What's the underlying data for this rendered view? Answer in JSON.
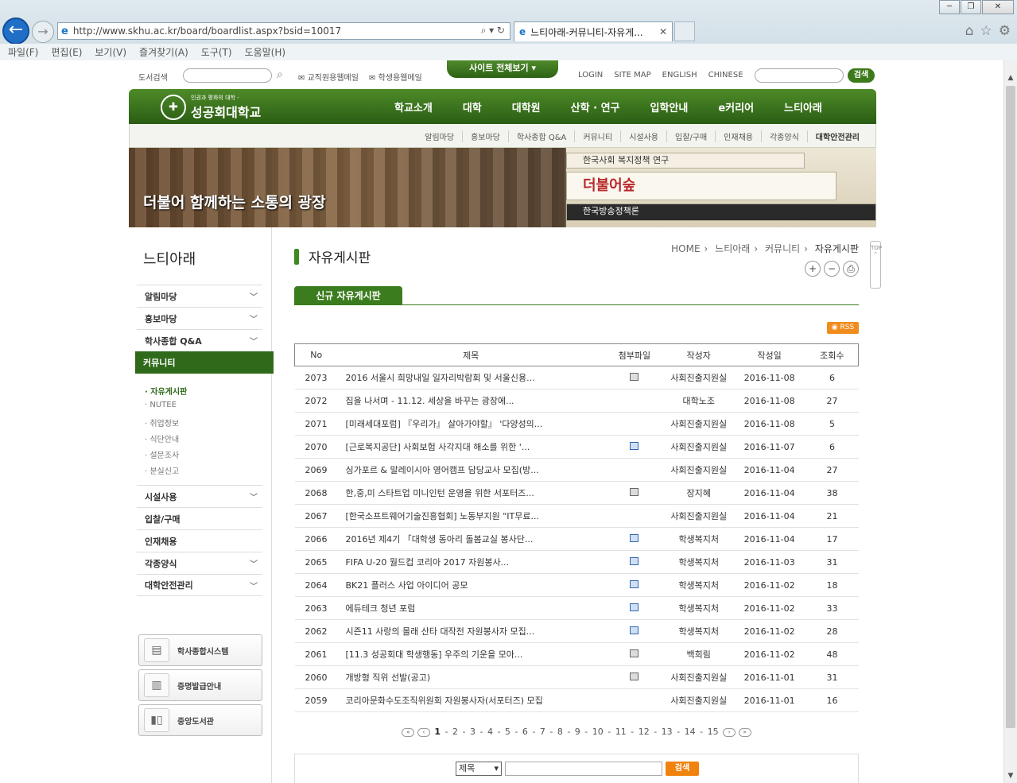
{
  "browser": {
    "url": "http://www.skhu.ac.kr/board/boardlist.aspx?bsid=10017",
    "tab_title": "느티아래-커뮤니티-자유게...",
    "menu": [
      "파일(F)",
      "편집(E)",
      "보기(V)",
      "즐겨찾기(A)",
      "도구(T)",
      "도움말(H)"
    ]
  },
  "util": {
    "library_search": "도서검색",
    "faculty_mail": "교직원용웹메일",
    "student_mail": "학생용웹메일",
    "sitemap_toggle": "사이트 전체보기",
    "links": [
      "LOGIN",
      "SITE MAP",
      "ENGLISH",
      "CHINESE"
    ],
    "search_button": "검색"
  },
  "logo": {
    "slogan": "인권과 평화의 대학 -",
    "name": "성공회대학교"
  },
  "gnb": [
    "학교소개",
    "대학",
    "대학원",
    "산학 · 연구",
    "입학안내",
    "e커리어",
    "느티아래"
  ],
  "lnb": [
    "알림마당",
    "홍보마당",
    "학사종합 Q&A",
    "커뮤니티",
    "시설사용",
    "입찰/구매",
    "인재채용",
    "각종양식",
    "대학안전관리"
  ],
  "banner": {
    "slogan": "더불어 함께하는 소통의 광장",
    "book1": "한국사회 복지정책 연구",
    "book2": "더불어숲",
    "book3": "한국방송정책론"
  },
  "sidebar": {
    "title": "느티아래",
    "items": [
      {
        "label": "알림마당",
        "chevron": true
      },
      {
        "label": "홍보마당",
        "chevron": true
      },
      {
        "label": "학사종합 Q&A",
        "chevron": true
      },
      {
        "label": "커뮤니티",
        "chevron": false
      }
    ],
    "sub": [
      "· 자유게시판",
      "· NUTEE",
      "· 취업정보",
      "· 식단안내",
      "· 설문조사",
      "· 분실신고"
    ],
    "items2": [
      {
        "label": "시설사용",
        "chevron": true
      },
      {
        "label": "입찰/구매",
        "chevron": false
      },
      {
        "label": "인재채용",
        "chevron": false
      },
      {
        "label": "각종양식",
        "chevron": true
      },
      {
        "label": "대학안전관리",
        "chevron": true
      }
    ],
    "quick": [
      "학사종합시스템",
      "증명발급안내",
      "중앙도서관"
    ]
  },
  "main": {
    "title": "자유게시판",
    "breadcrumb": [
      "HOME",
      "느티아래",
      "커뮤니티",
      "자유게시판"
    ],
    "board_tab": "신규 자유게시판",
    "rss": "RSS",
    "columns": [
      "No",
      "제목",
      "첨부파일",
      "작성자",
      "작성일",
      "조회수"
    ],
    "rows": [
      {
        "no": "2073",
        "title": "2016 서울시 희망내일 일자리박람회 및 서울신용...",
        "attach": "disk",
        "author": "사회진출지원실",
        "date": "2016-11-08",
        "views": "6"
      },
      {
        "no": "2072",
        "title": "집을 나서며 - 11.12. 세상을 바꾸는 광장에...",
        "attach": "",
        "author": "대학노조",
        "date": "2016-11-08",
        "views": "27"
      },
      {
        "no": "2071",
        "title": "[미래세대포럼] 『우리가』 살아가야할』 '다양성의...",
        "attach": "",
        "author": "사회진출지원실",
        "date": "2016-11-08",
        "views": "5"
      },
      {
        "no": "2070",
        "title": "[근로복지공단] 사회보험 사각지대 해소를 위한 '...",
        "attach": "doc",
        "author": "사회진출지원실",
        "date": "2016-11-07",
        "views": "6"
      },
      {
        "no": "2069",
        "title": "싱가포르 & 말레이시아 영어캠프 담당교사 모집(방...",
        "attach": "",
        "author": "사회진출지원실",
        "date": "2016-11-04",
        "views": "27"
      },
      {
        "no": "2068",
        "title": "한,중,미 스타트업 미니인턴 운영을 위한 서포터즈...",
        "attach": "disk",
        "author": "장지혜",
        "date": "2016-11-04",
        "views": "38"
      },
      {
        "no": "2067",
        "title": "[한국소프트웨어기술진흥협회] 노동부지원 \"IT무료...",
        "attach": "",
        "author": "사회진출지원실",
        "date": "2016-11-04",
        "views": "21"
      },
      {
        "no": "2066",
        "title": "2016년 제4기 「대학생 동아리 돌봄교실 봉사단...",
        "attach": "doc",
        "author": "학생복지처",
        "date": "2016-11-04",
        "views": "17"
      },
      {
        "no": "2065",
        "title": "FIFA U-20 월드컵 코리아 2017 자원봉사...",
        "attach": "doc",
        "author": "학생복지처",
        "date": "2016-11-03",
        "views": "31"
      },
      {
        "no": "2064",
        "title": "BK21 플러스 사업 아이디어 공모",
        "attach": "doc",
        "author": "학생복지처",
        "date": "2016-11-02",
        "views": "18"
      },
      {
        "no": "2063",
        "title": "에듀테크 청년 포럼",
        "attach": "doc",
        "author": "학생복지처",
        "date": "2016-11-02",
        "views": "33"
      },
      {
        "no": "2062",
        "title": "시즌11 사랑의 몰래 산타 대작전 자원봉사자 모집...",
        "attach": "doc",
        "author": "학생복지처",
        "date": "2016-11-02",
        "views": "28"
      },
      {
        "no": "2061",
        "title": "[11.3 성공회대 학생행동] 우주의 기운을 모아...",
        "attach": "disk",
        "author": "백희림",
        "date": "2016-11-02",
        "views": "48"
      },
      {
        "no": "2060",
        "title": "개방형 직위 선발(공고)",
        "attach": "disk",
        "author": "사회진출지원실",
        "date": "2016-11-01",
        "views": "31"
      },
      {
        "no": "2059",
        "title": "코리아문화수도조직위원회 자원봉사자(서포터즈) 모집",
        "attach": "",
        "author": "사회진출지원실",
        "date": "2016-11-01",
        "views": "16"
      }
    ],
    "pages": [
      "1",
      "2",
      "3",
      "4",
      "5",
      "6",
      "7",
      "8",
      "9",
      "10",
      "11",
      "12",
      "13",
      "14",
      "15"
    ],
    "current_page": "1",
    "search_select": "제목",
    "search_button": "검색"
  },
  "top_float": "TOP"
}
